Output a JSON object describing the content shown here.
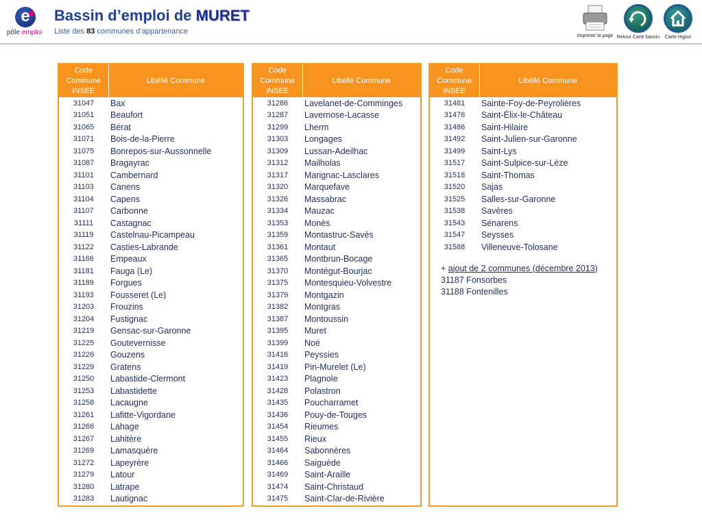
{
  "logo": {
    "letter": "e",
    "pole": "pôle",
    "emploi": "emploi"
  },
  "header": {
    "title_prefix": "Bassin d’emploi de ",
    "title_city": "MURET",
    "subtitle_pre": "Liste des ",
    "subtitle_count": "83",
    "subtitle_post": " communes d’appartenance"
  },
  "tools": {
    "print_label": "Imprimer la page",
    "retour_label": "Retour Carte bassin",
    "region_label": "Carte région"
  },
  "columns": {
    "code_header": "Code Commune INSEE",
    "name_header": "Libéllé Commune"
  },
  "table1": [
    [
      "31047",
      "Bax"
    ],
    [
      "31051",
      "Beaufort"
    ],
    [
      "31065",
      "Bérat"
    ],
    [
      "31071",
      "Bois-de-la-Pierre"
    ],
    [
      "31075",
      "Bonrepos-sur-Aussonnelle"
    ],
    [
      "31087",
      "Bragayrac"
    ],
    [
      "31101",
      "Cambernard"
    ],
    [
      "31103",
      "Canens"
    ],
    [
      "31104",
      "Capens"
    ],
    [
      "31107",
      "Carbonne"
    ],
    [
      "31111",
      "Castagnac"
    ],
    [
      "31119",
      "Castelnau-Picampeau"
    ],
    [
      "31122",
      "Casties-Labrande"
    ],
    [
      "31166",
      "Empeaux"
    ],
    [
      "31181",
      "Fauga  (Le)"
    ],
    [
      "31189",
      "Forgues"
    ],
    [
      "31193",
      "Fousseret  (Le)"
    ],
    [
      "31203",
      "Frouzins"
    ],
    [
      "31204",
      "Fustignac"
    ],
    [
      "31219",
      "Gensac-sur-Garonne"
    ],
    [
      "31225",
      "Goutevernisse"
    ],
    [
      "31226",
      "Gouzens"
    ],
    [
      "31229",
      "Gratens"
    ],
    [
      "31250",
      "Labastide-Clermont"
    ],
    [
      "31253",
      "Labastidette"
    ],
    [
      "31258",
      "Lacaugne"
    ],
    [
      "31261",
      "Lafitte-Vigordane"
    ],
    [
      "31266",
      "Lahage"
    ],
    [
      "31267",
      "Lahitère"
    ],
    [
      "31269",
      "Lamasquère"
    ],
    [
      "31272",
      "Lapeyrère"
    ],
    [
      "31279",
      "Latour"
    ],
    [
      "31280",
      "Latrape"
    ],
    [
      "31283",
      "Lautignac"
    ]
  ],
  "table2": [
    [
      "31286",
      "Lavelanet-de-Comminges"
    ],
    [
      "31287",
      "Lavernose-Lacasse"
    ],
    [
      "31299",
      "Lherm"
    ],
    [
      "31303",
      "Longages"
    ],
    [
      "31309",
      "Lussan-Adeilhac"
    ],
    [
      "31312",
      "Mailholas"
    ],
    [
      "31317",
      "Marignac-Lasclares"
    ],
    [
      "31320",
      "Marquefave"
    ],
    [
      "31326",
      "Massabrac"
    ],
    [
      "31334",
      "Mauzac"
    ],
    [
      "31353",
      "Monès"
    ],
    [
      "31359",
      "Montastruc-Savès"
    ],
    [
      "31361",
      "Montaut"
    ],
    [
      "31365",
      "Montbrun-Bocage"
    ],
    [
      "31370",
      "Montégut-Bourjac"
    ],
    [
      "31375",
      "Montesquieu-Volvestre"
    ],
    [
      "31379",
      "Montgazin"
    ],
    [
      "31382",
      "Montgras"
    ],
    [
      "31387",
      "Montoussin"
    ],
    [
      "31395",
      "Muret"
    ],
    [
      "31399",
      "Noé"
    ],
    [
      "31416",
      "Peyssies"
    ],
    [
      "31419",
      "Pin-Murelet  (Le)"
    ],
    [
      "31423",
      "Plagnole"
    ],
    [
      "31428",
      "Polastron"
    ],
    [
      "31435",
      "Poucharramet"
    ],
    [
      "31436",
      "Pouy-de-Touges"
    ],
    [
      "31454",
      "Rieumes"
    ],
    [
      "31455",
      "Rieux"
    ],
    [
      "31464",
      "Sabonnères"
    ],
    [
      "31466",
      "Saiguède"
    ],
    [
      "31469",
      "Saint-Araille"
    ],
    [
      "31474",
      "Saint-Christaud"
    ],
    [
      "31475",
      "Saint-Clar-de-Rivière"
    ]
  ],
  "table3": [
    [
      "31481",
      "Sainte-Foy-de-Peyrolières"
    ],
    [
      "31476",
      "Saint-Élix-le-Château"
    ],
    [
      "31486",
      "Saint-Hilaire"
    ],
    [
      "31492",
      "Saint-Julien-sur-Garonne"
    ],
    [
      "31499",
      "Saint-Lys"
    ],
    [
      "31517",
      "Saint-Sulpice-sur-Lèze"
    ],
    [
      "31518",
      "Saint-Thomas"
    ],
    [
      "31520",
      "Sajas"
    ],
    [
      "31525",
      "Salles-sur-Garonne"
    ],
    [
      "31538",
      "Savères"
    ],
    [
      "31543",
      "Sénarens"
    ],
    [
      "31547",
      "Seysses"
    ],
    [
      "31588",
      "Villeneuve-Tolosane"
    ]
  ],
  "note": {
    "plus": "+ ",
    "ajout": "ajout de 2 communes (décembre 2013)",
    "line1": "31187 Fonsorbes",
    "line2": "31188 Fontenilles"
  },
  "colors": {
    "orange": "#f7931e",
    "navy": "#1f2d5a",
    "title_blue": "#1f3f8f",
    "emploi_pink": "#e2007a"
  }
}
